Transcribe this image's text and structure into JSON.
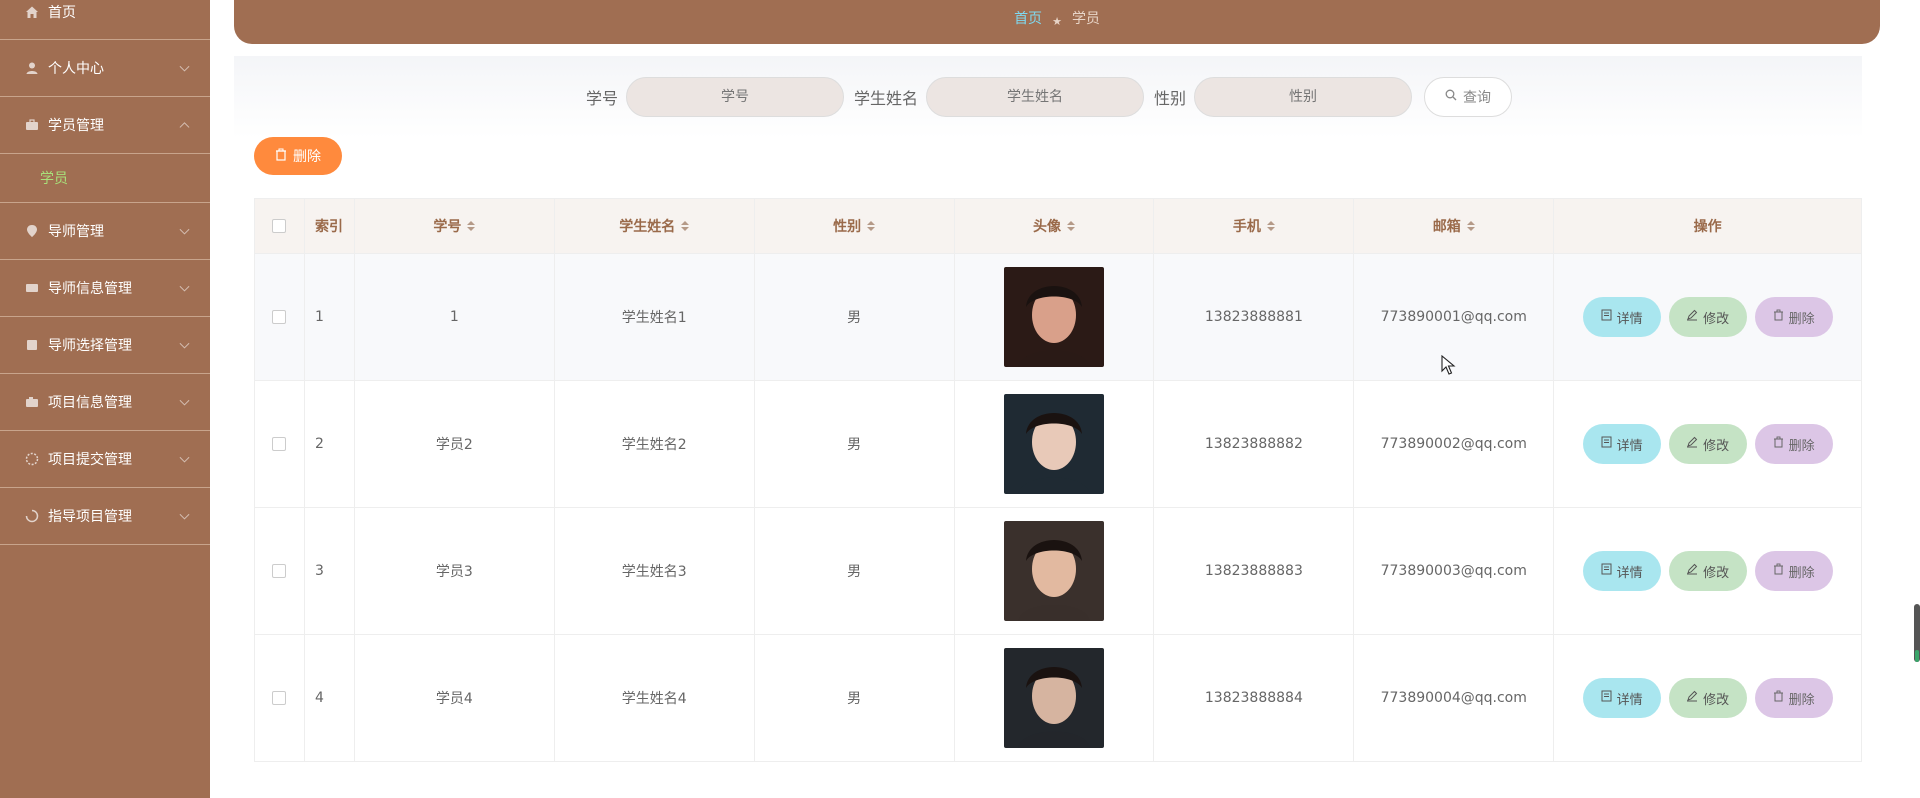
{
  "sidebar": {
    "items": [
      {
        "label": "首页",
        "icon": "home-icon"
      },
      {
        "label": "个人中心",
        "icon": "user-icon"
      },
      {
        "label": "学员管理",
        "icon": "briefcase-icon",
        "expanded": true,
        "children": [
          "学员"
        ]
      },
      {
        "label": "导师管理",
        "icon": "location-icon"
      },
      {
        "label": "导师信息管理",
        "icon": "id-card-icon"
      },
      {
        "label": "导师选择管理",
        "icon": "grid-icon"
      },
      {
        "label": "项目信息管理",
        "icon": "camera-icon"
      },
      {
        "label": "项目提交管理",
        "icon": "dashboard-icon"
      },
      {
        "label": "指导项目管理",
        "icon": "loading-icon"
      }
    ],
    "active_sub": "学员"
  },
  "breadcrumb": {
    "home": "首页",
    "separator": "★",
    "current": "学员"
  },
  "search": {
    "no_label": "学号",
    "no_placeholder": "学号",
    "name_label": "学生姓名",
    "name_placeholder": "学生姓名",
    "sex_label": "性别",
    "sex_placeholder": "性别",
    "query_label": "查询"
  },
  "toolbar": {
    "delete_label": "删除"
  },
  "table": {
    "headers": {
      "index": "索引",
      "no": "学号",
      "name": "学生姓名",
      "sex": "性别",
      "avatar": "头像",
      "phone": "手机",
      "email": "邮箱",
      "ops": "操作"
    },
    "rows": [
      {
        "index": "1",
        "no": "1",
        "name": "学生姓名1",
        "sex": "男",
        "phone": "13823888881",
        "email": "773890001@qq.com"
      },
      {
        "index": "2",
        "no": "学员2",
        "name": "学生姓名2",
        "sex": "男",
        "phone": "13823888882",
        "email": "773890002@qq.com"
      },
      {
        "index": "3",
        "no": "学员3",
        "name": "学生姓名3",
        "sex": "男",
        "phone": "13823888883",
        "email": "773890003@qq.com"
      },
      {
        "index": "4",
        "no": "学员4",
        "name": "学生姓名4",
        "sex": "男",
        "phone": "13823888884",
        "email": "773890004@qq.com"
      }
    ],
    "actions": {
      "detail": "详情",
      "edit": "修改",
      "delete": "删除"
    }
  },
  "colors": {
    "sidebar": "#a06e52",
    "accent_orange": "#ff8a3d",
    "detail": "#a9e6ef",
    "edit": "#c5e3c5",
    "delete": "#dcc6e6"
  }
}
